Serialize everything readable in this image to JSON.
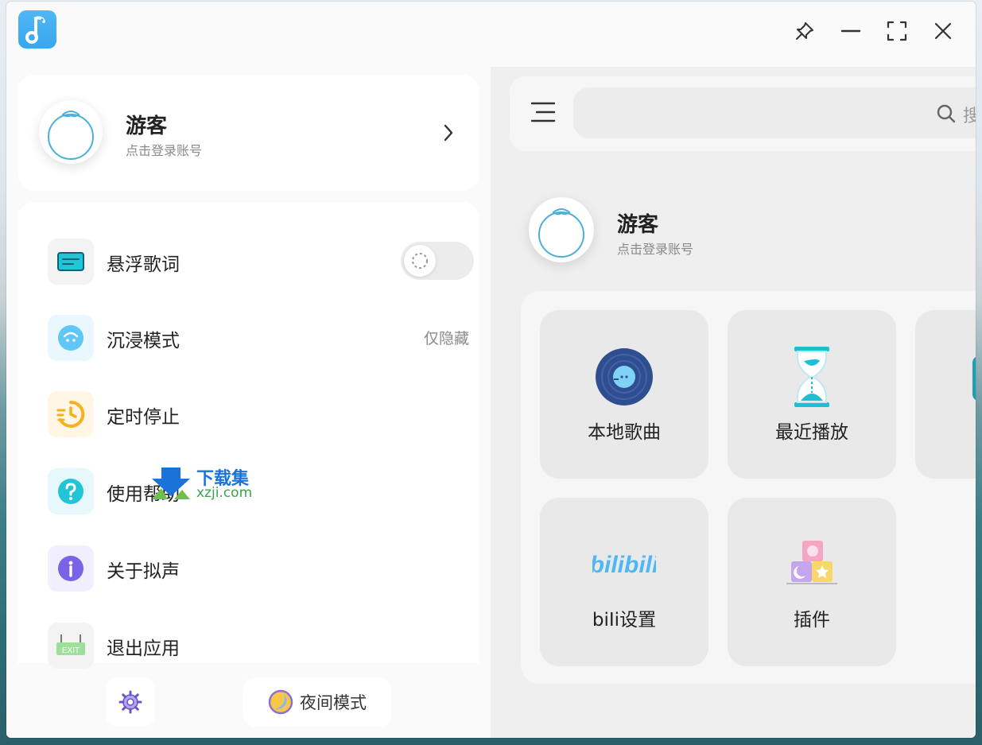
{
  "profile": {
    "name": "游客",
    "subtitle": "点击登录账号"
  },
  "menu": {
    "items": [
      {
        "label": "悬浮歌词",
        "icon": "lyrics-icon",
        "type": "toggle",
        "enabled": false
      },
      {
        "label": "沉浸模式",
        "icon": "immersive-icon",
        "value": "仅隐藏"
      },
      {
        "label": "定时停止",
        "icon": "timer-icon"
      },
      {
        "label": "使用帮助",
        "icon": "help-icon"
      },
      {
        "label": "关于拟声",
        "icon": "info-icon"
      },
      {
        "label": "退出应用",
        "icon": "exit-icon"
      }
    ]
  },
  "footer": {
    "night_mode_label": "夜间模式"
  },
  "search": {
    "placeholder_visible": "搜"
  },
  "right_profile": {
    "name": "游客",
    "subtitle": "点击登录账号"
  },
  "tiles": [
    {
      "label": "本地歌曲",
      "icon": "vinyl-icon"
    },
    {
      "label": "最近播放",
      "icon": "hourglass-icon"
    },
    {
      "label": "biIi设置",
      "icon": "bilibili-icon"
    },
    {
      "label": "插件",
      "icon": "blocks-icon"
    }
  ],
  "watermark": {
    "text_cn": "下载集",
    "text_en": "xzji.com"
  },
  "colors": {
    "accent": "#3aa6ef",
    "panel_bg": "#efefef",
    "tile_bg": "#e9e9e9"
  }
}
